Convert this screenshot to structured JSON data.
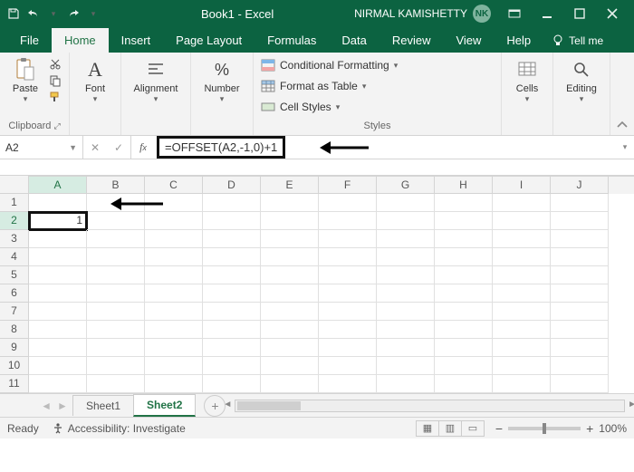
{
  "titlebar": {
    "doc_title": "Book1 - Excel",
    "user_name": "NIRMAL KAMISHETTY",
    "user_initials": "NK"
  },
  "tabs": {
    "file": "File",
    "home": "Home",
    "insert": "Insert",
    "page_layout": "Page Layout",
    "formulas": "Formulas",
    "data": "Data",
    "review": "Review",
    "view": "View",
    "help": "Help",
    "tell_me": "Tell me"
  },
  "ribbon": {
    "paste": "Paste",
    "font": "Font",
    "alignment": "Alignment",
    "number": "Number",
    "cond_fmt": "Conditional Formatting",
    "fmt_table": "Format as Table",
    "cell_styles": "Cell Styles",
    "cells": "Cells",
    "editing": "Editing",
    "grp_clipboard": "Clipboard",
    "grp_styles": "Styles"
  },
  "formula": {
    "namebox": "A2",
    "value": "=OFFSET(A2,-1,0)+1"
  },
  "grid": {
    "columns": [
      "A",
      "B",
      "C",
      "D",
      "E",
      "F",
      "G",
      "H",
      "I",
      "J"
    ],
    "rows": [
      "1",
      "2",
      "3",
      "4",
      "5",
      "6",
      "7",
      "8",
      "9",
      "10",
      "11"
    ],
    "selected_cell_value": "1"
  },
  "sheets": {
    "sheet1": "Sheet1",
    "sheet2": "Sheet2"
  },
  "status": {
    "ready": "Ready",
    "accessibility": "Accessibility: Investigate",
    "zoom": "100%"
  }
}
